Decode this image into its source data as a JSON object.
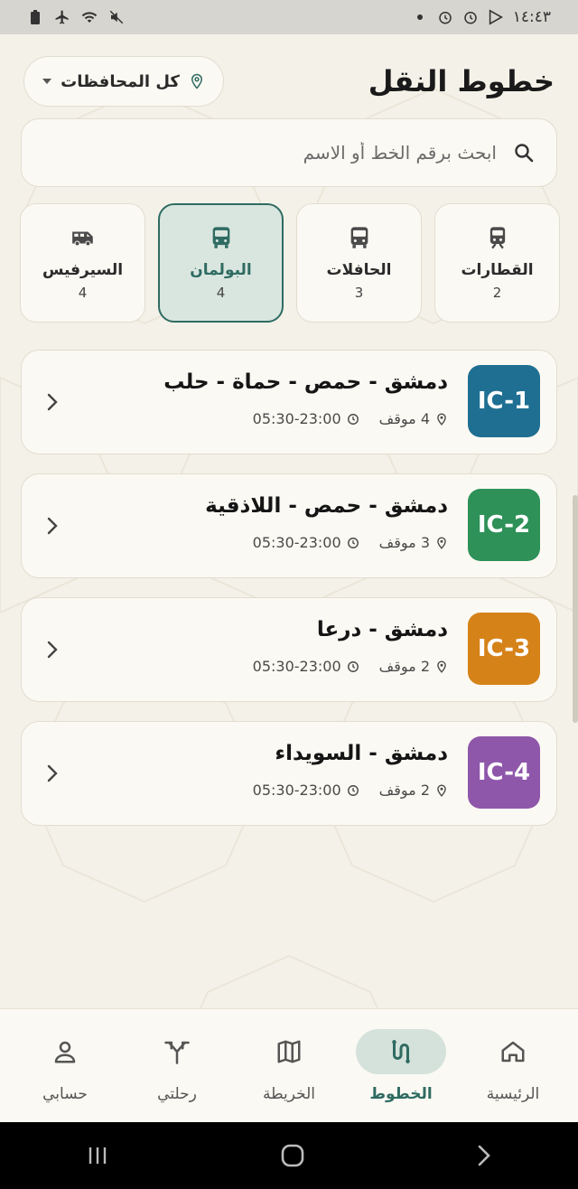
{
  "status_bar": {
    "time": "١٤:٤٣"
  },
  "header": {
    "title": "خطوط النقل",
    "governorate_label": "كل المحافظات"
  },
  "search": {
    "placeholder": "ابحث برقم الخط أو الاسم"
  },
  "transport_types": [
    {
      "label": "القطارات",
      "count": "2",
      "icon": "train-icon",
      "active": false
    },
    {
      "label": "الحافلات",
      "count": "3",
      "icon": "bus-icon",
      "active": false
    },
    {
      "label": "البولمان",
      "count": "4",
      "icon": "coach-icon",
      "active": true
    },
    {
      "label": "السيرفيس",
      "count": "4",
      "icon": "van-icon",
      "active": false
    }
  ],
  "lines": [
    {
      "code": "IC-1",
      "name": "دمشق - حمص - حماة - حلب",
      "stops": "4 موقف",
      "hours": "05:30-23:00",
      "color": "#1f6f93"
    },
    {
      "code": "IC-2",
      "name": "دمشق - حمص - اللاذقية",
      "stops": "3 موقف",
      "hours": "05:30-23:00",
      "color": "#2e9158"
    },
    {
      "code": "IC-3",
      "name": "دمشق - درعا",
      "stops": "2 موقف",
      "hours": "05:30-23:00",
      "color": "#d58219"
    },
    {
      "code": "IC-4",
      "name": "دمشق - السويداء",
      "stops": "2 موقف",
      "hours": "05:30-23:00",
      "color": "#8e57aa"
    }
  ],
  "bottom_nav": [
    {
      "label": "الرئيسية",
      "icon": "home-icon",
      "active": false
    },
    {
      "label": "الخطوط",
      "icon": "route-icon",
      "active": true
    },
    {
      "label": "الخريطة",
      "icon": "map-icon",
      "active": false
    },
    {
      "label": "رحلتي",
      "icon": "split-route-icon",
      "active": false
    },
    {
      "label": "حسابي",
      "icon": "user-icon",
      "active": false
    }
  ],
  "colors": {
    "accent": "#2f6b62",
    "background": "#f4f1e8",
    "card": "#fbf9f3"
  }
}
